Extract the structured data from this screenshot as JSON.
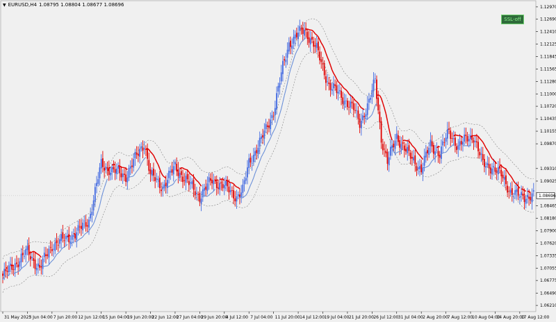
{
  "header": {
    "symbol_timeframe": "EURUSD,H4",
    "ohlc": "1.08795 1.08804 1.08677 1.08696"
  },
  "ssl_button": {
    "label": "SSL-off"
  },
  "colors": {
    "background": "#f0f0f0",
    "bull_candle": "#4169e1",
    "bear_candle": "#e00000",
    "ssl_up_line": "#6a8fd8",
    "ssl_down_line": "#e00000",
    "channel_line": "#808080"
  },
  "chart_data": {
    "type": "candlestick",
    "symbol": "EURUSD",
    "timeframe": "H4",
    "current_price": "1.08696",
    "y_ticks": [
      "1.12970",
      "1.12690",
      "1.12410",
      "1.12125",
      "1.11845",
      "1.11565",
      "1.11280",
      "1.11000",
      "1.10720",
      "1.10435",
      "1.10155",
      "1.09870",
      "1.09310",
      "1.09025",
      "1.08465",
      "1.08180",
      "1.07900",
      "1.07620",
      "1.07335",
      "1.07055",
      "1.06775",
      "1.06490",
      "1.06210"
    ],
    "y_tick_values": [
      1.1297,
      1.1269,
      1.1241,
      1.12125,
      1.11845,
      1.11565,
      1.1128,
      1.11,
      1.1072,
      1.10435,
      1.10155,
      1.0987,
      1.0931,
      1.09025,
      1.08465,
      1.0818,
      1.079,
      1.0762,
      1.07335,
      1.07055,
      1.06775,
      1.0649,
      1.0621
    ],
    "ylim": [
      1.0607,
      1.1311
    ],
    "x_ticks": [
      "31 May 2023",
      "5 Jun 04:00",
      "7 Jun 20:00",
      "12 Jun 12:00",
      "15 Jun 04:00",
      "19 Jun 20:00",
      "22 Jun 12:00",
      "27 Jun 04:00",
      "29 Jun 20:00",
      "4 Jul 12:00",
      "7 Jul 04:00",
      "11 Jul 20:00",
      "14 Jul 12:00",
      "19 Jul 04:00",
      "21 Jul 20:00",
      "26 Jul 12:00",
      "31 Jul 04:00",
      "2 Aug 20:00",
      "7 Aug 12:00",
      "10 Aug 04:00",
      "14 Aug 20:00",
      "17 Aug 12:00"
    ],
    "x_tick_index": [
      0,
      16,
      32,
      48,
      64,
      80,
      96,
      112,
      128,
      144,
      160,
      176,
      192,
      208,
      224,
      240,
      256,
      272,
      288,
      304,
      320,
      336
    ],
    "key_closes": [
      [
        0,
        1.0688
      ],
      [
        8,
        1.0715
      ],
      [
        16,
        1.0742
      ],
      [
        24,
        1.0705
      ],
      [
        32,
        1.0758
      ],
      [
        40,
        1.077
      ],
      [
        48,
        1.0785
      ],
      [
        56,
        1.0815
      ],
      [
        64,
        1.094
      ],
      [
        72,
        1.0925
      ],
      [
        80,
        1.0915
      ],
      [
        88,
        1.0965
      ],
      [
        92,
        1.099
      ],
      [
        96,
        1.0915
      ],
      [
        104,
        1.089
      ],
      [
        112,
        1.0935
      ],
      [
        120,
        1.09
      ],
      [
        128,
        1.0868
      ],
      [
        136,
        1.0905
      ],
      [
        144,
        1.089
      ],
      [
        152,
        1.0868
      ],
      [
        156,
        1.088
      ],
      [
        160,
        1.0945
      ],
      [
        168,
        1.0995
      ],
      [
        176,
        1.106
      ],
      [
        182,
        1.116
      ],
      [
        186,
        1.1215
      ],
      [
        192,
        1.1235
      ],
      [
        196,
        1.1245
      ],
      [
        200,
        1.1225
      ],
      [
        204,
        1.12
      ],
      [
        212,
        1.112
      ],
      [
        220,
        1.1095
      ],
      [
        228,
        1.1065
      ],
      [
        232,
        1.1035
      ],
      [
        238,
        1.108
      ],
      [
        242,
        1.113
      ],
      [
        246,
        1.1
      ],
      [
        250,
        1.0945
      ],
      [
        256,
        1.1005
      ],
      [
        264,
        1.096
      ],
      [
        272,
        1.093
      ],
      [
        278,
        1.0985
      ],
      [
        284,
        1.0965
      ],
      [
        290,
        1.1015
      ],
      [
        296,
        1.098
      ],
      [
        302,
        1.1
      ],
      [
        306,
        1.1005
      ],
      [
        312,
        1.094
      ],
      [
        318,
        1.0935
      ],
      [
        324,
        1.0915
      ],
      [
        330,
        1.088
      ],
      [
        336,
        1.0866
      ],
      [
        342,
        1.087
      ]
    ]
  }
}
